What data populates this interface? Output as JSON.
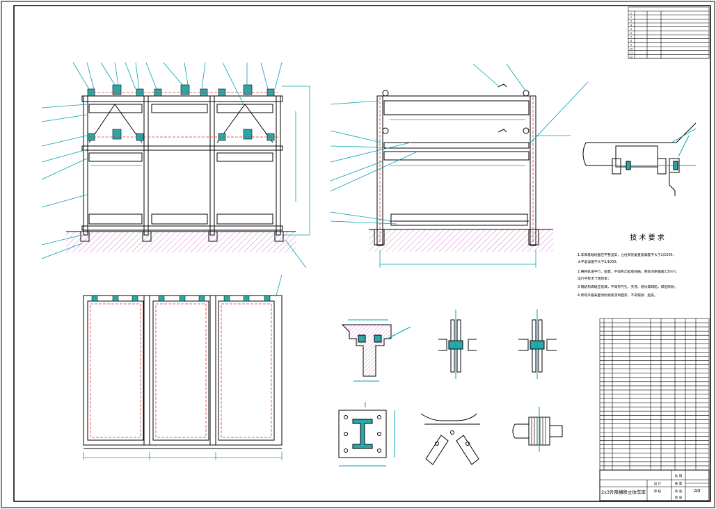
{
  "title_block": {
    "drawing_title": "2x3升降横移立体车库",
    "sheet_size": "A0",
    "cells": [
      "设 计",
      "审 核",
      "比 例",
      "重 量",
      "共 张",
      "第 张"
    ]
  },
  "tech_requirements": {
    "heading": "技 术 要 求",
    "items": [
      "1.车库基础地面应平整坚实，立柱安装垂直度偏差不大于2/1000，",
      "  水平度误差不大于2/1000；",
      "2.横移轨道平行、顺直，不得有凸起或扭曲，两轨间距偏差±3mm；",
      "  运行平稳无卡阻现象；",
      "3.钢结构焊缝应饱满，不得有气孔、夹渣、裂纹等缺陷，焊后除锈；",
      "4.所有外露表面涂防锈底漆和面漆，不得漏涂、起皮。"
    ]
  },
  "upper_table": {
    "rows": [
      "1",
      "2",
      "3",
      "4",
      "5",
      "6",
      "7",
      "8",
      "9",
      "10",
      "11",
      "12"
    ]
  },
  "parts_table": {
    "row_count": 36
  },
  "colors": {
    "line": "#000000",
    "accent": "#00a0b0",
    "hidden": "#d23a3a",
    "hatch": "#c04ac0",
    "gear": "#2aa8a8"
  }
}
